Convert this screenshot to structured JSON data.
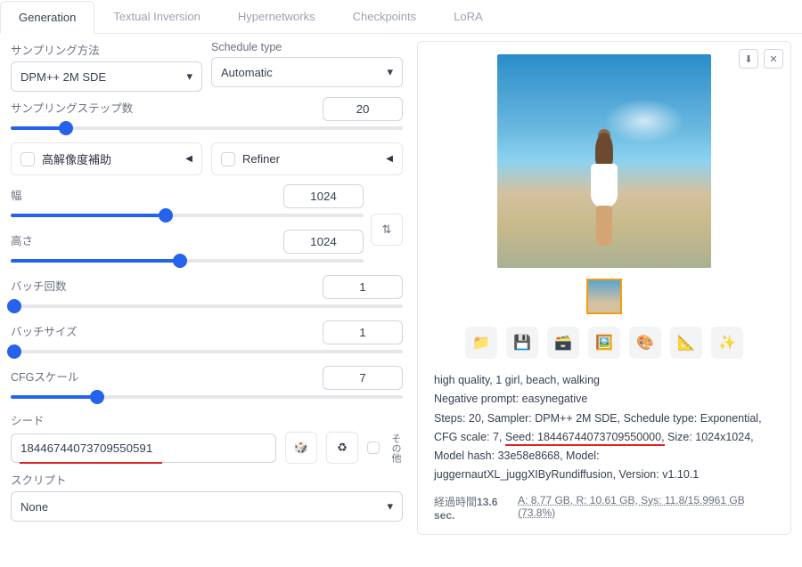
{
  "tabs": {
    "generation": "Generation",
    "ti": "Textual Inversion",
    "hn": "Hypernetworks",
    "ckpt": "Checkpoints",
    "lora": "LoRA"
  },
  "left": {
    "sampling_method_label": "サンプリング方法",
    "sampling_method": "DPM++ 2M SDE",
    "schedule_label": "Schedule type",
    "schedule": "Automatic",
    "steps_label": "サンプリングステップ数",
    "steps": "20",
    "hires_label": "高解像度補助",
    "refiner_label": "Refiner",
    "width_label": "幅",
    "width": "1024",
    "height_label": "高さ",
    "height": "1024",
    "batch_count_label": "バッチ回数",
    "batch_count": "1",
    "batch_size_label": "バッチサイズ",
    "batch_size": "1",
    "cfg_label": "CFGスケール",
    "cfg": "7",
    "seed_label": "シード",
    "seed": "18446744073709550591",
    "other_label": "その他",
    "script_label": "スクリプト",
    "script": "None"
  },
  "info": {
    "prompt": "high quality, 1 girl, beach, walking",
    "neg_label": "Negative prompt: ",
    "neg": "easynegative",
    "params1": "Steps: 20, Sampler: DPM++ 2M SDE, Schedule type: Exponential, CFG scale: 7, ",
    "seed_txt": "Seed: 18446744073709550000,",
    "params2": " Size: 1024x1024, Model hash: 33e58e8668, Model: juggernautXL_juggXIByRundiffusion, Version: v1.10.1"
  },
  "footer": {
    "time_label": "経過時間",
    "time": "13.6 sec.",
    "mem": "A: 8.77 GB, R: 10.61 GB, Sys: 11.8/15.9961 GB (73.8%)"
  },
  "slider_pct": {
    "steps": 14,
    "width": 44,
    "height": 48,
    "batch_count": 1,
    "batch_size": 1,
    "cfg": 22
  }
}
